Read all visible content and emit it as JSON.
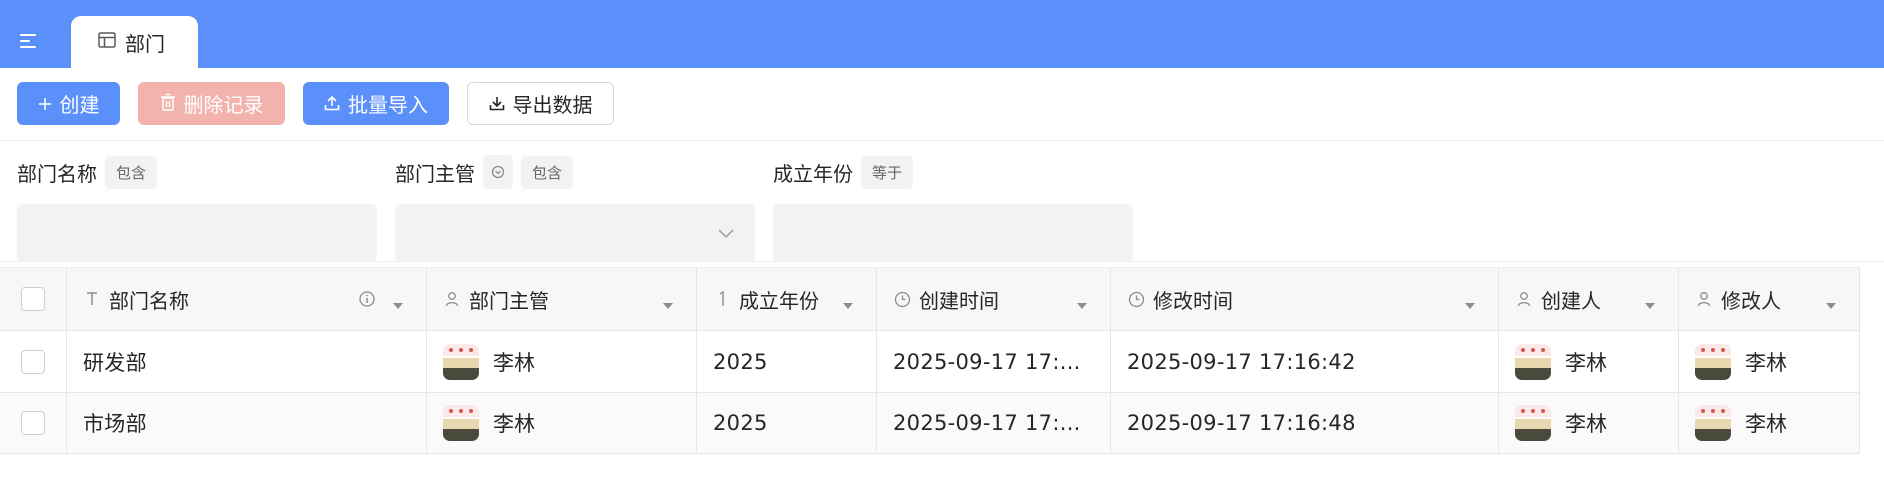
{
  "colors": {
    "primary": "#5b8ff9",
    "danger_disabled": "#f3b3ad",
    "filter_bg": "#f2f2f2",
    "header_bg": "#f7f7f7"
  },
  "tab": {
    "icon": "table-icon",
    "label": "部门"
  },
  "toolbar": {
    "create_label": "创建",
    "delete_label": "删除记录",
    "import_label": "批量导入",
    "export_label": "导出数据"
  },
  "filters": [
    {
      "label": "部门名称",
      "operator": "包含",
      "value": ""
    },
    {
      "label": "部门主管",
      "operator": "包含",
      "value": ""
    },
    {
      "label": "成立年份",
      "operator": "等于",
      "value": ""
    }
  ],
  "table": {
    "columns": [
      {
        "label": "部门名称",
        "icon": "text-type-icon"
      },
      {
        "label": "部门主管",
        "icon": "user-icon"
      },
      {
        "label": "成立年份",
        "icon": "number-type-icon"
      },
      {
        "label": "创建时间",
        "icon": "clock-icon"
      },
      {
        "label": "修改时间",
        "icon": "clock-icon"
      },
      {
        "label": "创建人",
        "icon": "user-icon"
      },
      {
        "label": "修改人",
        "icon": "user-icon"
      }
    ],
    "rows": [
      {
        "name": "研发部",
        "manager": "李林",
        "year": "2025",
        "created_at": "2025-09-17 17:...",
        "updated_at": "2025-09-17 17:16:42",
        "creator": "李林",
        "modifier": "李林"
      },
      {
        "name": "市场部",
        "manager": "李林",
        "year": "2025",
        "created_at": "2025-09-17 17:...",
        "updated_at": "2025-09-17 17:16:48",
        "creator": "李林",
        "modifier": "李林"
      }
    ]
  }
}
